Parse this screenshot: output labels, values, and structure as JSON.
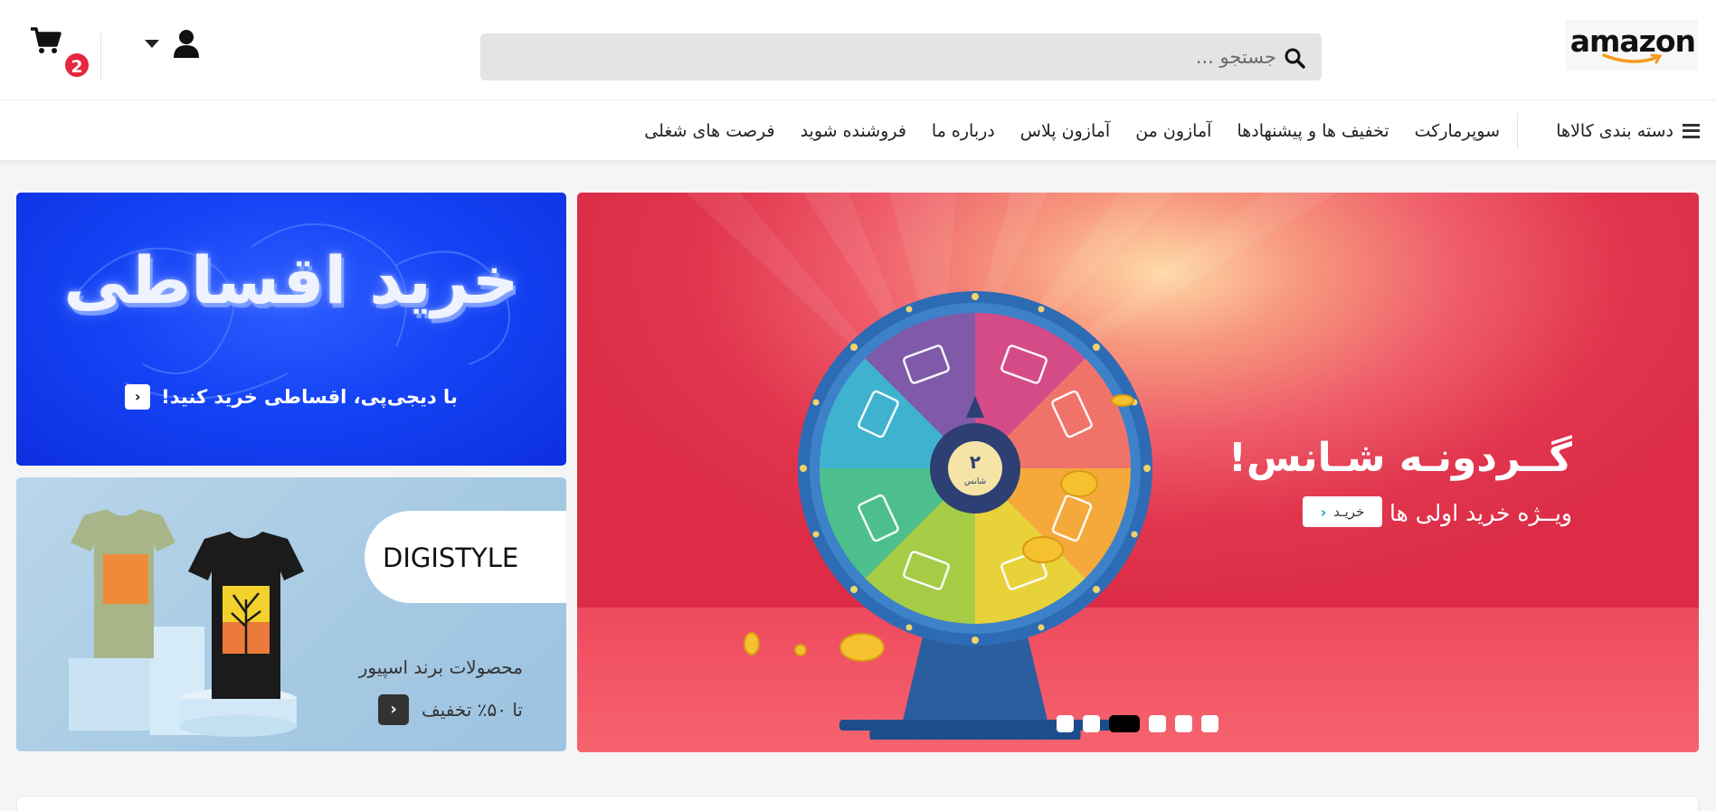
{
  "header": {
    "logo_text": "amazon",
    "search_placeholder": "جستجو ...",
    "cart_count": "2",
    "icons": {
      "search": "search-icon",
      "user": "user-icon",
      "caret": "caret-down-icon",
      "cart": "cart-icon"
    }
  },
  "nav": {
    "categories_label": "دسته بندی کالاها",
    "links": [
      "سوپرمارکت",
      "تخفیف ها و پیشنهادها",
      "آمازون من",
      "آمازون پلاس",
      "درباره ما",
      "فروشنده شوید",
      "فرصت های شغلی"
    ]
  },
  "hero": {
    "title": "گــردونـه شـانس!",
    "subtitle": "ویــژه خرید اولی ها",
    "button_label": "خریـد",
    "wheel_center_number": "۲",
    "wheel_center_label": "شانس",
    "slides_count": 6,
    "active_slide": 3
  },
  "installment_banner": {
    "headline": "خرید اقساطی",
    "subtitle": "با دیجی‌پی، اقساطی خرید کنید!"
  },
  "digistyle_banner": {
    "brand": "DIGISTYLE",
    "products": "محصولات برند اسپیور",
    "discount": "تا ۵۰٪ تخفیف"
  },
  "colors": {
    "hero_red": "#dc2c47",
    "installment_blue": "#1544f5",
    "digistyle_bg": "#a6c9e3",
    "badge_red": "#e5283d",
    "search_bg": "#e4e4e4"
  }
}
